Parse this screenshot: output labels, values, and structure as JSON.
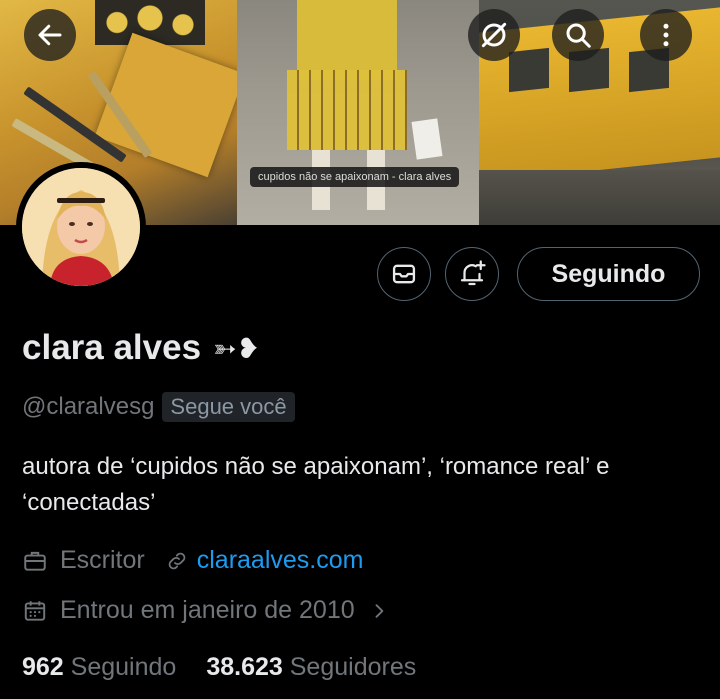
{
  "banner": {
    "caption": "cupidos não se apaixonam - clara alves"
  },
  "icons": {
    "back": "back-arrow-icon",
    "grok": "grok-icon",
    "search": "search-icon",
    "more": "more-vertical-icon",
    "message": "mail-icon",
    "notify": "bell-plus-icon",
    "job": "briefcase-icon",
    "link": "link-icon",
    "calendar": "calendar-icon",
    "chevron": "chevron-right-icon"
  },
  "profile": {
    "name": "clara alves",
    "name_suffix": "➳❥",
    "handle": "@claralvesg",
    "follows_you": "Segue você",
    "bio": "autora de ‘cupidos não se apaixonam’, ‘romance real’ e ‘conectadas’",
    "occupation": "Escritor",
    "website": "claraalves.com",
    "joined": "Entrou em janeiro de 2010",
    "following_count": "962",
    "following_label": "Seguindo",
    "followers_count": "38.623",
    "followers_label": "Seguidores"
  },
  "actions": {
    "following_button": "Seguindo"
  },
  "colors": {
    "background": "#000000",
    "text": "#e7e9ea",
    "muted": "#71767b",
    "link": "#1d9bf0",
    "border": "#536471"
  }
}
